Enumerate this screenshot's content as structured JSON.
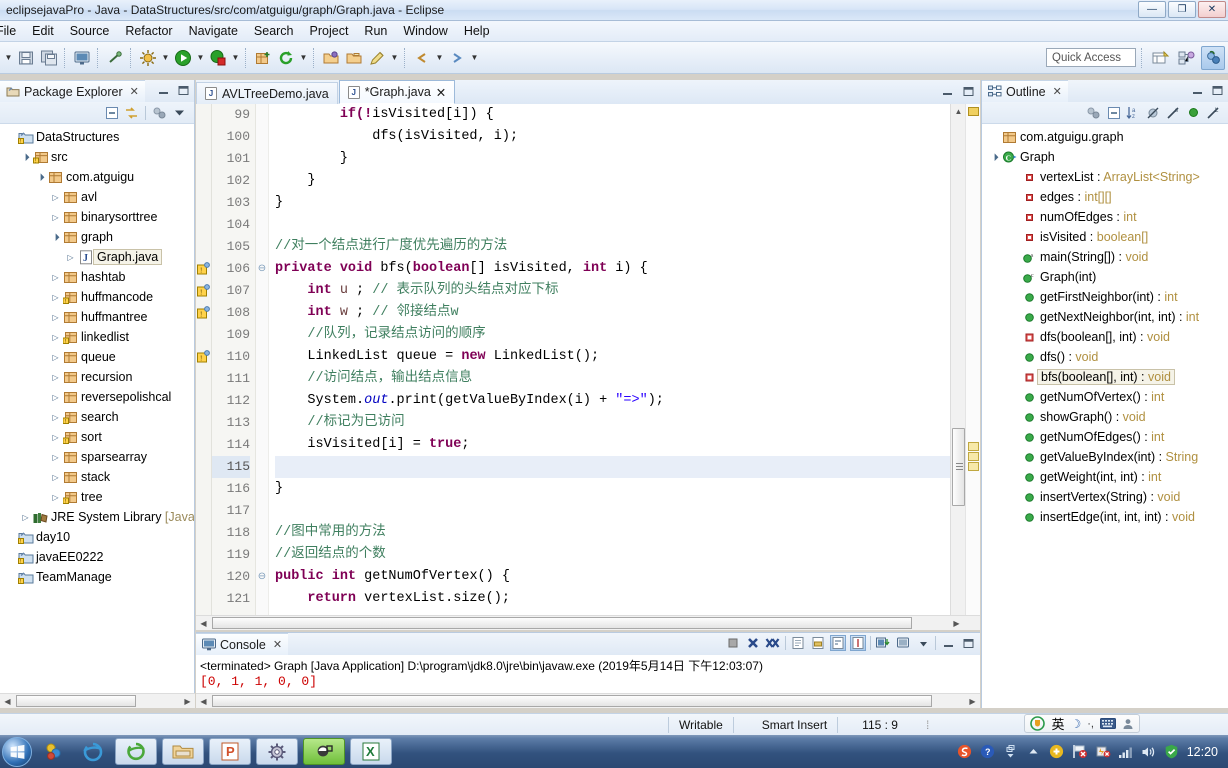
{
  "window": {
    "title": "eclipsejavaPro - Java - DataStructures/src/com/atguigu/graph/Graph.java - Eclipse",
    "minimize": "—",
    "maximize": "❐",
    "close": "✕"
  },
  "menubar": {
    "items": [
      {
        "label": "File"
      },
      {
        "label": "Edit"
      },
      {
        "label": "Source"
      },
      {
        "label": "Refactor"
      },
      {
        "label": "Navigate"
      },
      {
        "label": "Search"
      },
      {
        "label": "Project"
      },
      {
        "label": "Run"
      },
      {
        "label": "Window"
      },
      {
        "label": "Help"
      }
    ]
  },
  "toolbar": {
    "quick_access_placeholder": "Quick Access",
    "icons": [
      "new-dropdown-icon",
      "save-icon",
      "save-all-icon",
      "console-icon",
      "link-break-icon",
      "debug-icon",
      "run-icon",
      "coverage-icon",
      "new-java-package-icon",
      "refresh-icon",
      "open-type-icon",
      "open-task-icon",
      "marker-icon",
      "previous-edit-icon"
    ],
    "right_icons": [
      "open-perspective-icon",
      "java-ee-perspective-icon",
      "java-perspective-icon"
    ]
  },
  "package_explorer": {
    "tab_label": "Package Explorer",
    "close_glyph": "✕",
    "view_buttons": [
      "minimize-view-button",
      "maximize-view-button"
    ],
    "toolbar_icons": [
      "collapse-all-icon",
      "link-with-editor-icon",
      "focus-icon",
      "view-menu-icon"
    ],
    "tree": [
      {
        "label": "DataStructures",
        "depth": 0,
        "arrow": "",
        "icon": "java-project-icon",
        "selected": false
      },
      {
        "label": "src",
        "depth": 1,
        "arrow": "▲",
        "icon": "source-folder-icon",
        "selected": false
      },
      {
        "label": "com.atguigu",
        "depth": 2,
        "arrow": "▲",
        "icon": "package-icon",
        "selected": false
      },
      {
        "label": "avl",
        "depth": 3,
        "arrow": "▷",
        "icon": "package-icon",
        "selected": false
      },
      {
        "label": "binarysorttree",
        "depth": 3,
        "arrow": "▷",
        "icon": "package-icon",
        "selected": false
      },
      {
        "label": "graph",
        "depth": 3,
        "arrow": "▲",
        "icon": "package-icon",
        "selected": false
      },
      {
        "label": "Graph.java",
        "depth": 4,
        "arrow": "▷",
        "icon": "java-file-icon",
        "selected": true
      },
      {
        "label": "hashtab",
        "depth": 3,
        "arrow": "▷",
        "icon": "package-icon",
        "selected": false
      },
      {
        "label": "huffmancode",
        "depth": 3,
        "arrow": "▷",
        "icon": "package-warning-icon",
        "selected": false
      },
      {
        "label": "huffmantree",
        "depth": 3,
        "arrow": "▷",
        "icon": "package-icon",
        "selected": false
      },
      {
        "label": "linkedlist",
        "depth": 3,
        "arrow": "▷",
        "icon": "package-warning-icon",
        "selected": false
      },
      {
        "label": "queue",
        "depth": 3,
        "arrow": "▷",
        "icon": "package-icon",
        "selected": false
      },
      {
        "label": "recursion",
        "depth": 3,
        "arrow": "▷",
        "icon": "package-icon",
        "selected": false
      },
      {
        "label": "reversepolishcal",
        "depth": 3,
        "arrow": "▷",
        "icon": "package-icon",
        "selected": false
      },
      {
        "label": "search",
        "depth": 3,
        "arrow": "▷",
        "icon": "package-warning-icon",
        "selected": false
      },
      {
        "label": "sort",
        "depth": 3,
        "arrow": "▷",
        "icon": "package-warning-icon",
        "selected": false
      },
      {
        "label": "sparsearray",
        "depth": 3,
        "arrow": "▷",
        "icon": "package-icon",
        "selected": false
      },
      {
        "label": "stack",
        "depth": 3,
        "arrow": "▷",
        "icon": "package-icon",
        "selected": false
      },
      {
        "label": "tree",
        "depth": 3,
        "arrow": "▷",
        "icon": "package-warning-icon",
        "selected": false
      },
      {
        "label": "JRE System Library [JavaS",
        "depth": 1,
        "arrow": "▷",
        "icon": "jre-library-icon",
        "selected": false
      },
      {
        "label": "day10",
        "depth": 0,
        "arrow": "",
        "icon": "java-project-icon",
        "selected": false
      },
      {
        "label": "javaEE0222",
        "depth": 0,
        "arrow": "",
        "icon": "java-project-icon",
        "selected": false
      },
      {
        "label": "TeamManage",
        "depth": 0,
        "arrow": "",
        "icon": "java-project-icon",
        "selected": false
      }
    ]
  },
  "editor": {
    "tabs": [
      {
        "label": "AVLTreeDemo.java",
        "active": false,
        "dirty": false,
        "close_glyph": ""
      },
      {
        "label": "*Graph.java",
        "active": true,
        "dirty": true,
        "close_glyph": "✕"
      }
    ],
    "tab_controls": [
      "minimize-editor-button",
      "maximize-editor-button"
    ],
    "current_line": 115,
    "lines": [
      {
        "num": 99,
        "fold": "",
        "anno": "",
        "indent": 8,
        "tokens": [
          {
            "t": "if(!",
            "c": "kw"
          },
          {
            "t": "isVisited",
            "c": "plain"
          },
          {
            "t": "[i]) {",
            "c": "plain"
          }
        ]
      },
      {
        "num": 100,
        "fold": "",
        "anno": "",
        "indent": 12,
        "tokens": [
          {
            "t": "dfs(isVisited, i);",
            "c": "plain"
          }
        ]
      },
      {
        "num": 101,
        "fold": "",
        "anno": "",
        "indent": 8,
        "tokens": [
          {
            "t": "}",
            "c": "plain"
          }
        ]
      },
      {
        "num": 102,
        "fold": "",
        "anno": "",
        "indent": 4,
        "tokens": [
          {
            "t": "}",
            "c": "plain"
          }
        ]
      },
      {
        "num": 103,
        "fold": "",
        "anno": "",
        "indent": 0,
        "tokens": [
          {
            "t": "}",
            "c": "plain"
          }
        ]
      },
      {
        "num": 104,
        "fold": "",
        "anno": "",
        "indent": 0,
        "tokens": []
      },
      {
        "num": 105,
        "fold": "",
        "anno": "marker",
        "indent": 0,
        "tokens": [
          {
            "t": "//对一个结点进行广度优先遍历的方法",
            "c": "cmt"
          }
        ]
      },
      {
        "num": 106,
        "fold": "⊖",
        "anno": "warn",
        "indent": 0,
        "tokens": [
          {
            "t": "private",
            "c": "kw"
          },
          {
            "t": " ",
            "c": "plain"
          },
          {
            "t": "void",
            "c": "kw"
          },
          {
            "t": " bfs(",
            "c": "plain"
          },
          {
            "t": "boolean",
            "c": "kw"
          },
          {
            "t": "[] isVisited, ",
            "c": "plain"
          },
          {
            "t": "int",
            "c": "kw"
          },
          {
            "t": " i) {",
            "c": "plain"
          }
        ]
      },
      {
        "num": 107,
        "fold": "",
        "anno": "warn",
        "indent": 4,
        "tokens": [
          {
            "t": "int",
            "c": "kw"
          },
          {
            "t": " ",
            "c": "plain"
          },
          {
            "t": "u",
            "c": "lclvar"
          },
          {
            "t": " ; ",
            "c": "plain"
          },
          {
            "t": "// 表示队列的头结点对应下标",
            "c": "cmt"
          }
        ]
      },
      {
        "num": 108,
        "fold": "",
        "anno": "warn",
        "indent": 4,
        "tokens": [
          {
            "t": "int",
            "c": "kw"
          },
          {
            "t": " ",
            "c": "plain"
          },
          {
            "t": "w",
            "c": "lclvar"
          },
          {
            "t": " ; ",
            "c": "plain"
          },
          {
            "t": "// 邻接结点w",
            "c": "cmt"
          }
        ]
      },
      {
        "num": 109,
        "fold": "",
        "anno": "",
        "indent": 4,
        "tokens": [
          {
            "t": "//队列，记录结点访问的顺序",
            "c": "cmt"
          }
        ]
      },
      {
        "num": 110,
        "fold": "",
        "anno": "warn",
        "indent": 4,
        "tokens": [
          {
            "t": "LinkedList",
            "c": "plain"
          },
          {
            "t": " queue = ",
            "c": "plain"
          },
          {
            "t": "new",
            "c": "kw"
          },
          {
            "t": " LinkedList();",
            "c": "plain"
          }
        ]
      },
      {
        "num": 111,
        "fold": "",
        "anno": "",
        "indent": 4,
        "tokens": [
          {
            "t": "//访问结点，输出结点信息",
            "c": "cmt"
          }
        ]
      },
      {
        "num": 112,
        "fold": "",
        "anno": "",
        "indent": 4,
        "tokens": [
          {
            "t": "System.",
            "c": "plain"
          },
          {
            "t": "out",
            "c": "fld"
          },
          {
            "t": ".print(getValueByIndex(i) + ",
            "c": "plain"
          },
          {
            "t": "\"=>\"",
            "c": "str"
          },
          {
            "t": ");",
            "c": "plain"
          }
        ]
      },
      {
        "num": 113,
        "fold": "",
        "anno": "",
        "indent": 4,
        "tokens": [
          {
            "t": "//标记为已访问",
            "c": "cmt"
          }
        ]
      },
      {
        "num": 114,
        "fold": "",
        "anno": "",
        "indent": 4,
        "tokens": [
          {
            "t": "isVisited[i] = ",
            "c": "plain"
          },
          {
            "t": "true",
            "c": "kw"
          },
          {
            "t": ";",
            "c": "plain"
          }
        ]
      },
      {
        "num": 115,
        "fold": "",
        "anno": "",
        "indent": 4,
        "tokens": []
      },
      {
        "num": 116,
        "fold": "",
        "anno": "",
        "indent": 0,
        "tokens": [
          {
            "t": "}",
            "c": "plain"
          }
        ]
      },
      {
        "num": 117,
        "fold": "",
        "anno": "",
        "indent": 0,
        "tokens": []
      },
      {
        "num": 118,
        "fold": "",
        "anno": "",
        "indent": 0,
        "tokens": [
          {
            "t": "//图中常用的方法",
            "c": "cmt"
          }
        ]
      },
      {
        "num": 119,
        "fold": "",
        "anno": "",
        "indent": 0,
        "tokens": [
          {
            "t": "//返回结点的个数",
            "c": "cmt"
          }
        ]
      },
      {
        "num": 120,
        "fold": "⊖",
        "anno": "",
        "indent": 0,
        "tokens": [
          {
            "t": "public",
            "c": "kw"
          },
          {
            "t": " ",
            "c": "plain"
          },
          {
            "t": "int",
            "c": "kw"
          },
          {
            "t": " getNumOfVertex() {",
            "c": "plain"
          }
        ]
      },
      {
        "num": 121,
        "fold": "",
        "anno": "",
        "indent": 4,
        "tokens": [
          {
            "t": "return",
            "c": "kw"
          },
          {
            "t": " vertexList.size();",
            "c": "plain"
          }
        ]
      }
    ]
  },
  "outline": {
    "tab_label": "Outline",
    "close_glyph": "✕",
    "toolbar_icons": [
      "focus-icon",
      "collapse-all-icon",
      "sort-icon",
      "hide-fields-icon",
      "hide-static-icon",
      "hide-nonpublic-icon",
      "hide-local-icon"
    ],
    "items": [
      {
        "label": "com.atguigu.graph",
        "type": "",
        "depth": 0,
        "icon": "package-icon",
        "arrow": "",
        "selected": false
      },
      {
        "label": "Graph",
        "type": "",
        "depth": 0,
        "icon": "class-icon",
        "arrow": "▲",
        "selected": false
      },
      {
        "label": "vertexList : ",
        "type": "ArrayList<String>",
        "depth": 1,
        "icon": "private-field-icon",
        "arrow": "",
        "selected": false
      },
      {
        "label": "edges : ",
        "type": "int[][]",
        "depth": 1,
        "icon": "private-field-icon",
        "arrow": "",
        "selected": false
      },
      {
        "label": "numOfEdges : ",
        "type": "int",
        "depth": 1,
        "icon": "private-field-icon",
        "arrow": "",
        "selected": false
      },
      {
        "label": "isVisited : ",
        "type": "boolean[]",
        "depth": 1,
        "icon": "private-field-icon",
        "arrow": "",
        "selected": false
      },
      {
        "label": "main(String[]) : ",
        "type": "void",
        "depth": 1,
        "icon": "public-static-method-icon",
        "arrow": "",
        "selected": false
      },
      {
        "label": "Graph(int)",
        "type": "",
        "depth": 1,
        "icon": "constructor-icon",
        "arrow": "",
        "selected": false
      },
      {
        "label": "getFirstNeighbor(int) : ",
        "type": "int",
        "depth": 1,
        "icon": "public-method-icon",
        "arrow": "",
        "selected": false
      },
      {
        "label": "getNextNeighbor(int, int) : ",
        "type": "int",
        "depth": 1,
        "icon": "public-method-icon",
        "arrow": "",
        "selected": false
      },
      {
        "label": "dfs(boolean[], int) : ",
        "type": "void",
        "depth": 1,
        "icon": "private-method-icon",
        "arrow": "",
        "selected": false
      },
      {
        "label": "dfs() : ",
        "type": "void",
        "depth": 1,
        "icon": "public-method-icon",
        "arrow": "",
        "selected": false
      },
      {
        "label": "bfs(boolean[], int) : ",
        "type": "void",
        "depth": 1,
        "icon": "private-method-icon",
        "arrow": "",
        "selected": true
      },
      {
        "label": "getNumOfVertex() : ",
        "type": "int",
        "depth": 1,
        "icon": "public-method-icon",
        "arrow": "",
        "selected": false
      },
      {
        "label": "showGraph() : ",
        "type": "void",
        "depth": 1,
        "icon": "public-method-icon",
        "arrow": "",
        "selected": false
      },
      {
        "label": "getNumOfEdges() : ",
        "type": "int",
        "depth": 1,
        "icon": "public-method-icon",
        "arrow": "",
        "selected": false
      },
      {
        "label": "getValueByIndex(int) : ",
        "type": "String",
        "depth": 1,
        "icon": "public-method-icon",
        "arrow": "",
        "selected": false
      },
      {
        "label": "getWeight(int, int) : ",
        "type": "int",
        "depth": 1,
        "icon": "public-method-icon",
        "arrow": "",
        "selected": false
      },
      {
        "label": "insertVertex(String) : ",
        "type": "void",
        "depth": 1,
        "icon": "public-method-icon",
        "arrow": "",
        "selected": false
      },
      {
        "label": "insertEdge(int, int, int) : ",
        "type": "void",
        "depth": 1,
        "icon": "public-method-icon",
        "arrow": "",
        "selected": false
      }
    ]
  },
  "console": {
    "tab_label": "Console",
    "close_glyph": "✕",
    "toolbar_icons": [
      "terminate-icon",
      "remove-launch-icon",
      "remove-all-terminated-icon",
      "clear-console-icon",
      "scroll-lock-icon",
      "word-wrap-icon",
      "pin-console-icon",
      "display-selected-console-icon",
      "open-console-icon",
      "view-menu-icon"
    ],
    "view_buttons": [
      "minimize-console-button",
      "maximize-console-button"
    ],
    "terminated_line": "<terminated> Graph [Java Application] D:\\program\\jdk8.0\\jre\\bin\\javaw.exe (2019年5月14日 下午12:03:07)",
    "output_line": "[0, 1, 1, 0, 0]"
  },
  "statusbar": {
    "writable": "Writable",
    "insert_mode": "Smart Insert",
    "position": "115 : 9"
  },
  "ime": {
    "logo": "sogou-ime-icon",
    "mode": "英",
    "moon": "☽",
    "punct": "·,",
    "keyboard": "keyboard-icon",
    "user": "user-icon"
  },
  "taskbar": {
    "start": "start-orb-icon",
    "quick_launch": [
      "show-desktop-icon",
      "internet-explorer-icon"
    ],
    "buttons": [
      {
        "icon": "edge-browser-icon",
        "active": false
      },
      {
        "icon": "file-explorer-icon",
        "active": false
      },
      {
        "icon": "powerpoint-icon",
        "active": false
      },
      {
        "icon": "settings-icon",
        "active": false
      },
      {
        "icon": "eclipse-icon",
        "active": true
      },
      {
        "icon": "excel-icon",
        "active": false
      }
    ],
    "tray_icons": [
      "sogou-icon",
      "help-icon",
      "expand-tray-icon",
      "update-icon",
      "network-flag-icon",
      "battery-icon",
      "signal-icon",
      "volume-icon",
      "security-icon"
    ],
    "clock": "12:20"
  },
  "colors": {
    "keyword": "#7f0055",
    "comment": "#3f7f5f",
    "string": "#2a00ff",
    "field": "#0000c0",
    "current_line": "#e8eef8",
    "selection": "#f5f3e8",
    "taskbar": "#32527e"
  }
}
